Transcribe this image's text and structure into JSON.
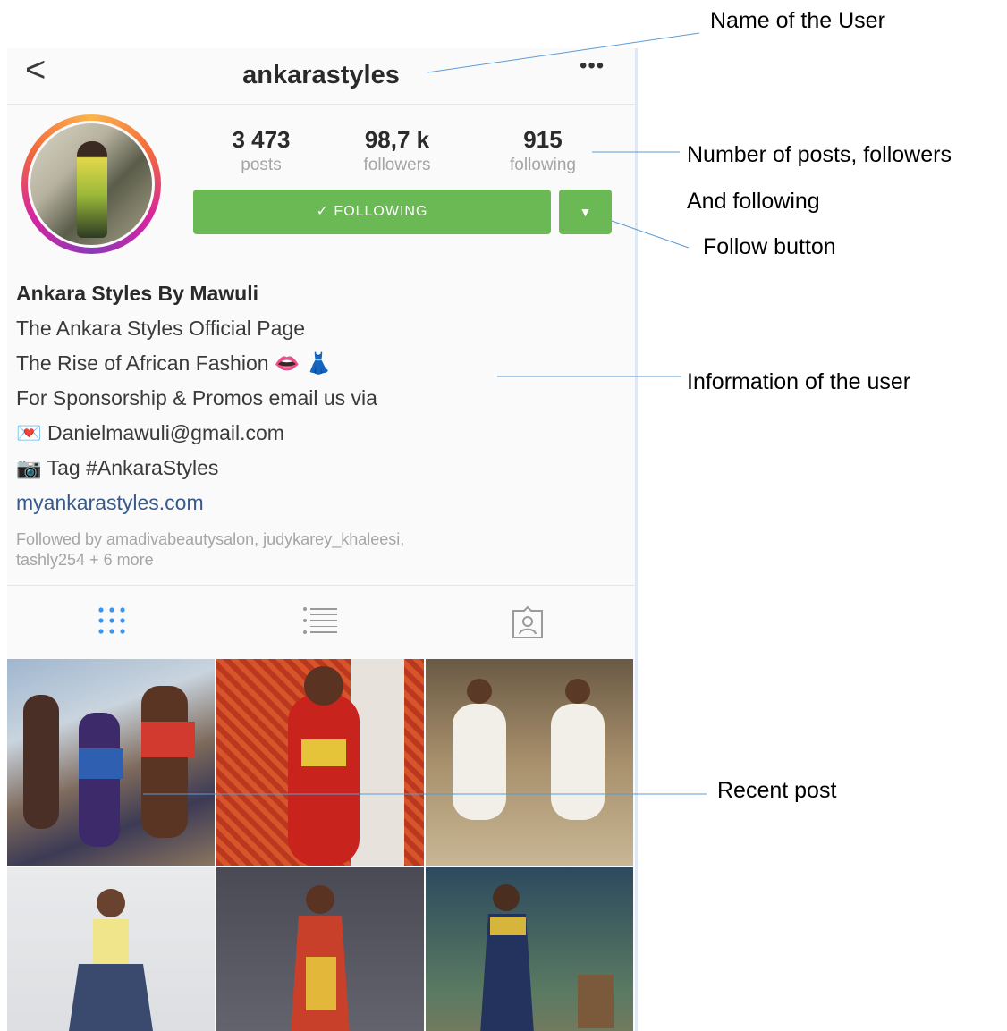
{
  "header": {
    "username": "ankarastyles",
    "back_glyph": "<",
    "more_glyph": "•••"
  },
  "stats": [
    {
      "value": "3 473",
      "label": "posts"
    },
    {
      "value": "98,7 k",
      "label": "followers"
    },
    {
      "value": "915",
      "label": "following"
    }
  ],
  "follow": {
    "label": "✓ FOLLOWING",
    "dropdown_glyph": "▼"
  },
  "bio": {
    "name": "Ankara Styles By Mawuli",
    "line1": "The Ankara Styles Official Page",
    "line2": "The Rise of African Fashion 👄 👗",
    "line3": "For Sponsorship & Promos email us via",
    "line4": "💌 Danielmawuli@gmail.com",
    "line5": "📷 Tag #AnkaraStyles",
    "website": "myankarastyles.com",
    "followed_by_1": "Followed by amadivabeautysalon, judykarey_khaleesi,",
    "followed_by_2": "tashly254 + 6 more"
  },
  "tabs": [
    {
      "icon": "grid-icon",
      "active": true
    },
    {
      "icon": "list-icon",
      "active": false
    },
    {
      "icon": "tagged-icon",
      "active": false
    }
  ],
  "annotations": {
    "name_of_user": "Name of the User",
    "stats_1": "Number of posts, followers",
    "stats_2": "And following",
    "follow_button": "Follow button",
    "information": "Information of the user",
    "recent_post": "Recent post"
  },
  "colors": {
    "follow_green": "#6ab955",
    "tab_active": "#3897f0",
    "link": "#375a8a",
    "annotation_line": "#5b9bd5"
  }
}
